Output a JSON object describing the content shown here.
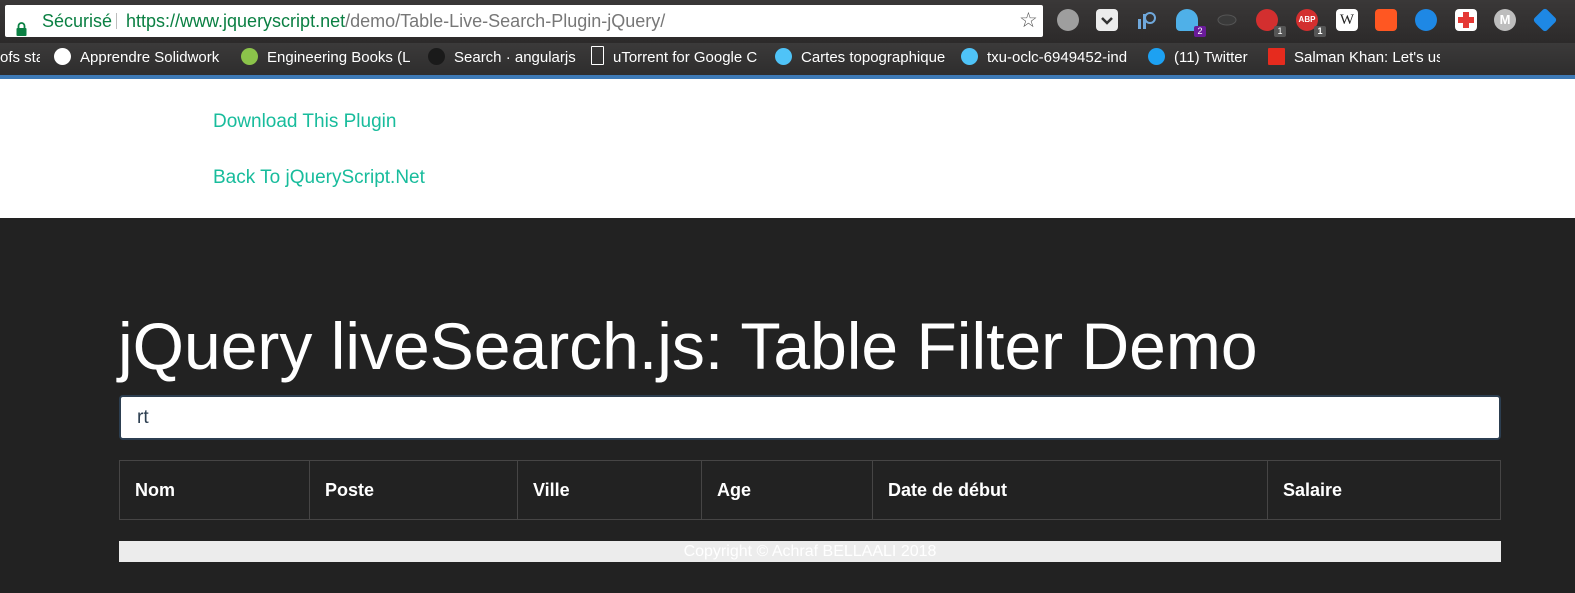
{
  "browser": {
    "secure_label": "Sécurisé",
    "url_scheme": "https://",
    "url_host": "www.jqueryscript.net",
    "url_path": "/demo/Table-Live-Search-Plugin-jQuery/",
    "extension_badges": [
      "2",
      "1",
      "1"
    ],
    "bookmarks": [
      {
        "label": "ofs sta",
        "icon": "image-icon"
      },
      {
        "label": "Apprendre Solidwork",
        "icon": "wordpress-icon"
      },
      {
        "label": "Engineering Books (L",
        "icon": "recycle-icon"
      },
      {
        "label": "Search · angularjs",
        "icon": "github-icon"
      },
      {
        "label": "uTorrent for Google C",
        "icon": "page-icon"
      },
      {
        "label": "Cartes topographique",
        "icon": "globe-icon"
      },
      {
        "label": "txu-oclc-6949452-ind",
        "icon": "globe-icon"
      },
      {
        "label": "(11) Twitter",
        "icon": "twitter-icon"
      },
      {
        "label": "Salman Khan: Let's us",
        "icon": "ted-icon"
      }
    ]
  },
  "header": {
    "download_label": "Download This Plugin",
    "back_label": "Back To jQueryScript.Net"
  },
  "main": {
    "title": "jQuery liveSearch.js: Table Filter Demo",
    "search_value": "rt",
    "table": {
      "columns": [
        "Nom",
        "Poste",
        "Ville",
        "Age",
        "Date de début",
        "Salaire"
      ]
    },
    "footer": "Copyright © Achraf BELLAALI 2018"
  },
  "colors": {
    "link": "#18bc9c",
    "page_background": "#222222",
    "secure_green": "#0b8043"
  }
}
